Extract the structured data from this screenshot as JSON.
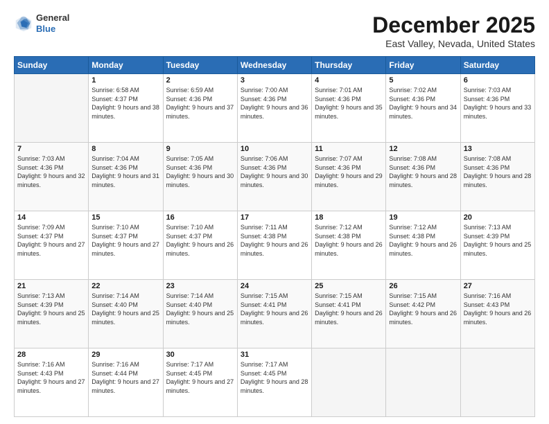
{
  "logo": {
    "general": "General",
    "blue": "Blue"
  },
  "title": "December 2025",
  "subtitle": "East Valley, Nevada, United States",
  "days_header": [
    "Sunday",
    "Monday",
    "Tuesday",
    "Wednesday",
    "Thursday",
    "Friday",
    "Saturday"
  ],
  "weeks": [
    [
      {
        "day": "",
        "sunrise": "",
        "sunset": "",
        "daylight": ""
      },
      {
        "day": "1",
        "sunrise": "Sunrise: 6:58 AM",
        "sunset": "Sunset: 4:37 PM",
        "daylight": "Daylight: 9 hours and 38 minutes."
      },
      {
        "day": "2",
        "sunrise": "Sunrise: 6:59 AM",
        "sunset": "Sunset: 4:36 PM",
        "daylight": "Daylight: 9 hours and 37 minutes."
      },
      {
        "day": "3",
        "sunrise": "Sunrise: 7:00 AM",
        "sunset": "Sunset: 4:36 PM",
        "daylight": "Daylight: 9 hours and 36 minutes."
      },
      {
        "day": "4",
        "sunrise": "Sunrise: 7:01 AM",
        "sunset": "Sunset: 4:36 PM",
        "daylight": "Daylight: 9 hours and 35 minutes."
      },
      {
        "day": "5",
        "sunrise": "Sunrise: 7:02 AM",
        "sunset": "Sunset: 4:36 PM",
        "daylight": "Daylight: 9 hours and 34 minutes."
      },
      {
        "day": "6",
        "sunrise": "Sunrise: 7:03 AM",
        "sunset": "Sunset: 4:36 PM",
        "daylight": "Daylight: 9 hours and 33 minutes."
      }
    ],
    [
      {
        "day": "7",
        "sunrise": "Sunrise: 7:03 AM",
        "sunset": "Sunset: 4:36 PM",
        "daylight": "Daylight: 9 hours and 32 minutes."
      },
      {
        "day": "8",
        "sunrise": "Sunrise: 7:04 AM",
        "sunset": "Sunset: 4:36 PM",
        "daylight": "Daylight: 9 hours and 31 minutes."
      },
      {
        "day": "9",
        "sunrise": "Sunrise: 7:05 AM",
        "sunset": "Sunset: 4:36 PM",
        "daylight": "Daylight: 9 hours and 30 minutes."
      },
      {
        "day": "10",
        "sunrise": "Sunrise: 7:06 AM",
        "sunset": "Sunset: 4:36 PM",
        "daylight": "Daylight: 9 hours and 30 minutes."
      },
      {
        "day": "11",
        "sunrise": "Sunrise: 7:07 AM",
        "sunset": "Sunset: 4:36 PM",
        "daylight": "Daylight: 9 hours and 29 minutes."
      },
      {
        "day": "12",
        "sunrise": "Sunrise: 7:08 AM",
        "sunset": "Sunset: 4:36 PM",
        "daylight": "Daylight: 9 hours and 28 minutes."
      },
      {
        "day": "13",
        "sunrise": "Sunrise: 7:08 AM",
        "sunset": "Sunset: 4:36 PM",
        "daylight": "Daylight: 9 hours and 28 minutes."
      }
    ],
    [
      {
        "day": "14",
        "sunrise": "Sunrise: 7:09 AM",
        "sunset": "Sunset: 4:37 PM",
        "daylight": "Daylight: 9 hours and 27 minutes."
      },
      {
        "day": "15",
        "sunrise": "Sunrise: 7:10 AM",
        "sunset": "Sunset: 4:37 PM",
        "daylight": "Daylight: 9 hours and 27 minutes."
      },
      {
        "day": "16",
        "sunrise": "Sunrise: 7:10 AM",
        "sunset": "Sunset: 4:37 PM",
        "daylight": "Daylight: 9 hours and 26 minutes."
      },
      {
        "day": "17",
        "sunrise": "Sunrise: 7:11 AM",
        "sunset": "Sunset: 4:38 PM",
        "daylight": "Daylight: 9 hours and 26 minutes."
      },
      {
        "day": "18",
        "sunrise": "Sunrise: 7:12 AM",
        "sunset": "Sunset: 4:38 PM",
        "daylight": "Daylight: 9 hours and 26 minutes."
      },
      {
        "day": "19",
        "sunrise": "Sunrise: 7:12 AM",
        "sunset": "Sunset: 4:38 PM",
        "daylight": "Daylight: 9 hours and 26 minutes."
      },
      {
        "day": "20",
        "sunrise": "Sunrise: 7:13 AM",
        "sunset": "Sunset: 4:39 PM",
        "daylight": "Daylight: 9 hours and 25 minutes."
      }
    ],
    [
      {
        "day": "21",
        "sunrise": "Sunrise: 7:13 AM",
        "sunset": "Sunset: 4:39 PM",
        "daylight": "Daylight: 9 hours and 25 minutes."
      },
      {
        "day": "22",
        "sunrise": "Sunrise: 7:14 AM",
        "sunset": "Sunset: 4:40 PM",
        "daylight": "Daylight: 9 hours and 25 minutes."
      },
      {
        "day": "23",
        "sunrise": "Sunrise: 7:14 AM",
        "sunset": "Sunset: 4:40 PM",
        "daylight": "Daylight: 9 hours and 25 minutes."
      },
      {
        "day": "24",
        "sunrise": "Sunrise: 7:15 AM",
        "sunset": "Sunset: 4:41 PM",
        "daylight": "Daylight: 9 hours and 26 minutes."
      },
      {
        "day": "25",
        "sunrise": "Sunrise: 7:15 AM",
        "sunset": "Sunset: 4:41 PM",
        "daylight": "Daylight: 9 hours and 26 minutes."
      },
      {
        "day": "26",
        "sunrise": "Sunrise: 7:15 AM",
        "sunset": "Sunset: 4:42 PM",
        "daylight": "Daylight: 9 hours and 26 minutes."
      },
      {
        "day": "27",
        "sunrise": "Sunrise: 7:16 AM",
        "sunset": "Sunset: 4:43 PM",
        "daylight": "Daylight: 9 hours and 26 minutes."
      }
    ],
    [
      {
        "day": "28",
        "sunrise": "Sunrise: 7:16 AM",
        "sunset": "Sunset: 4:43 PM",
        "daylight": "Daylight: 9 hours and 27 minutes."
      },
      {
        "day": "29",
        "sunrise": "Sunrise: 7:16 AM",
        "sunset": "Sunset: 4:44 PM",
        "daylight": "Daylight: 9 hours and 27 minutes."
      },
      {
        "day": "30",
        "sunrise": "Sunrise: 7:17 AM",
        "sunset": "Sunset: 4:45 PM",
        "daylight": "Daylight: 9 hours and 27 minutes."
      },
      {
        "day": "31",
        "sunrise": "Sunrise: 7:17 AM",
        "sunset": "Sunset: 4:45 PM",
        "daylight": "Daylight: 9 hours and 28 minutes."
      },
      {
        "day": "",
        "sunrise": "",
        "sunset": "",
        "daylight": ""
      },
      {
        "day": "",
        "sunrise": "",
        "sunset": "",
        "daylight": ""
      },
      {
        "day": "",
        "sunrise": "",
        "sunset": "",
        "daylight": ""
      }
    ]
  ]
}
